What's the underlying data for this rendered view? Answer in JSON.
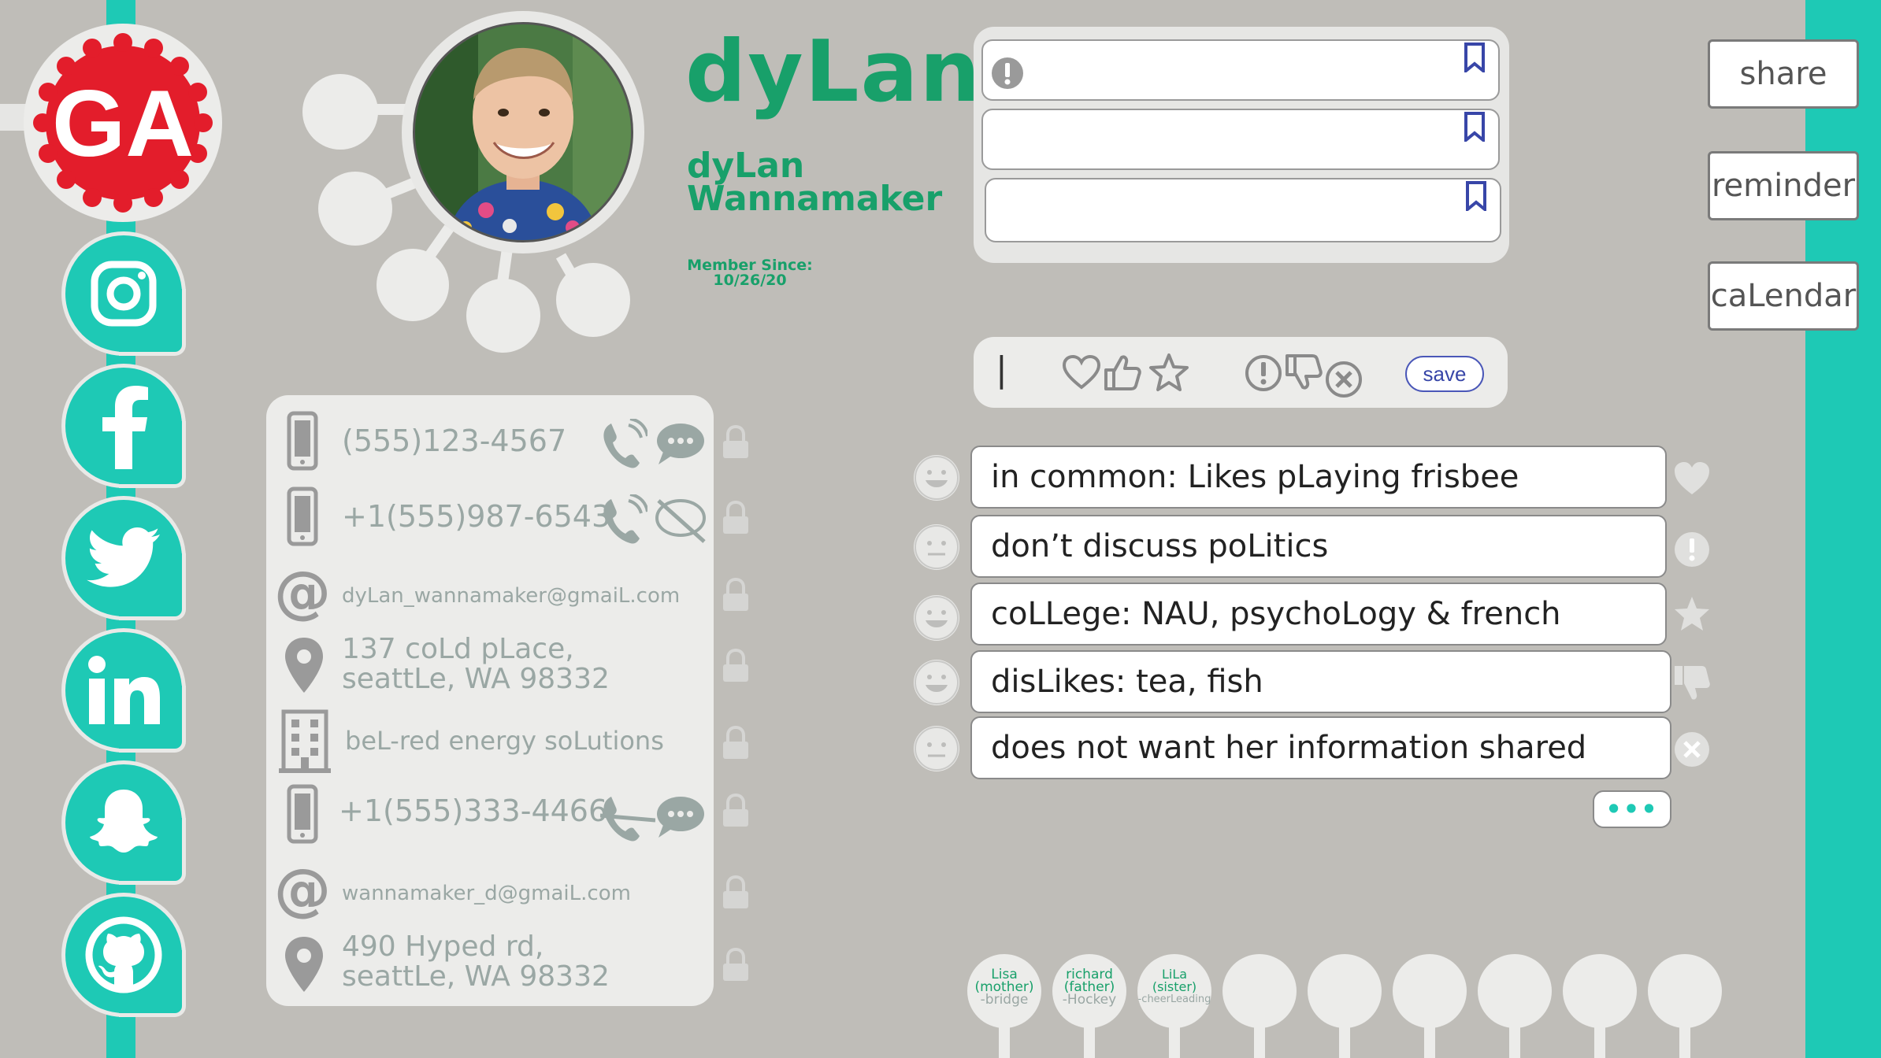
{
  "profile": {
    "nickname": "dyLan",
    "full_name_first": "dyLan",
    "full_name_last": "Wannamaker",
    "member_since_label": "Member Since:",
    "member_since_date": "10/26/20"
  },
  "brand": {
    "badge_text": "GA"
  },
  "social": [
    "instagram-icon",
    "facebook-icon",
    "twitter-icon",
    "linkedin-icon",
    "snapchat-icon",
    "github-icon"
  ],
  "notes": {
    "items": [
      "",
      "",
      ""
    ]
  },
  "reaction_bar": {
    "cursor": "|",
    "save_label": "save"
  },
  "contacts": {
    "phone1": "(555)123-4567",
    "phone2": "+1(555)987-6543",
    "email1": "dyLan_wannamaker@gmaiL.com",
    "address1_line1": "137 coLd pLace,",
    "address1_line2": "seattLe, WA 98332",
    "company": "beL-red energy soLutions",
    "phone3": "+1(555)333-4466",
    "email2": "wannamaker_d@gmaiL.com",
    "address2_line1": "490 Hyped rd,",
    "address2_line2": "seattLe, WA 98332"
  },
  "facts": [
    {
      "text": "in common: Likes pLaying frisbee",
      "tag": "heart-icon"
    },
    {
      "text": "don’t discuss poLitics",
      "tag": "alert-icon"
    },
    {
      "text": "coLLege: NAU, psychoLogy & french",
      "tag": "star-icon"
    },
    {
      "text": "disLikes: tea, fish",
      "tag": "thumbs-down-icon"
    },
    {
      "text": "does not want her information shared",
      "tag": "x-circle-icon"
    }
  ],
  "more_label": "•••",
  "actions": {
    "share": "share",
    "reminder": "reminder",
    "calendar": "caLendar"
  },
  "family": [
    {
      "name": "Lisa",
      "relation": "(mother)",
      "note": "-bridge"
    },
    {
      "name": "richard",
      "relation": "(father)",
      "note": "-Hockey"
    },
    {
      "name": "LiLa",
      "relation": "(sister)",
      "note": "-cheerLeading"
    }
  ],
  "colors": {
    "teal": "#1ec9b5",
    "green": "#18a06a",
    "red": "#e31d2b",
    "background": "#bfbdb8"
  }
}
